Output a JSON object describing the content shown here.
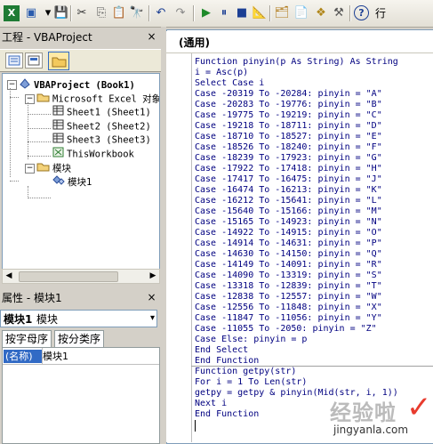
{
  "toolbar": {
    "buttons": [
      {
        "name": "excel-icon",
        "glyph": "X",
        "color": "#1e7b34"
      },
      {
        "name": "insert-userform-icon",
        "glyph": "▣",
        "color": "#2b5cad"
      },
      {
        "name": "dropdown-arrow-icon",
        "glyph": "▾",
        "color": "#000"
      },
      {
        "name": "save-icon",
        "glyph": "💾",
        "color": "#1c3f94"
      },
      {
        "name": "cut-icon",
        "glyph": "✂",
        "color": "#333"
      },
      {
        "name": "copy-icon",
        "glyph": "⎘",
        "color": "#555"
      },
      {
        "name": "paste-icon",
        "glyph": "📋",
        "color": "#8a6d1c"
      },
      {
        "name": "find-icon",
        "glyph": "🔭",
        "color": "#333"
      },
      {
        "name": "undo-icon",
        "glyph": "↶",
        "color": "#1c3f94"
      },
      {
        "name": "redo-icon",
        "glyph": "↷",
        "color": "#888"
      },
      {
        "name": "run-icon",
        "glyph": "▶",
        "color": "#1e8a2a"
      },
      {
        "name": "break-icon",
        "glyph": "⏸",
        "color": "#1c3f94"
      },
      {
        "name": "reset-icon",
        "glyph": "■",
        "color": "#1c3f94"
      },
      {
        "name": "design-mode-icon",
        "glyph": "📐",
        "color": "#1c3f94"
      },
      {
        "name": "project-explorer-icon",
        "glyph": "🗂",
        "color": "#b07a1a"
      },
      {
        "name": "properties-window-icon",
        "glyph": "📄",
        "color": "#3a6bbf"
      },
      {
        "name": "object-browser-icon",
        "glyph": "❖",
        "color": "#b0861a"
      },
      {
        "name": "toolbox-icon",
        "glyph": "⚒",
        "color": "#555"
      },
      {
        "name": "help-icon",
        "glyph": "?",
        "color": "#1c3f94"
      },
      {
        "name": "line-indicator",
        "glyph": "行",
        "color": "#000"
      }
    ]
  },
  "project_pane": {
    "title": "工程 - VBAProject",
    "close": "×",
    "tree": [
      {
        "label": "VBAProject (Book1)",
        "level": 0,
        "kind": "project"
      },
      {
        "label": "Microsoft Excel 对象",
        "level": 1,
        "kind": "folder"
      },
      {
        "label": "Sheet1 (Sheet1)",
        "level": 2,
        "kind": "sheet"
      },
      {
        "label": "Sheet2 (Sheet2)",
        "level": 2,
        "kind": "sheet"
      },
      {
        "label": "Sheet3 (Sheet3)",
        "level": 2,
        "kind": "sheet"
      },
      {
        "label": "ThisWorkbook",
        "level": 2,
        "kind": "workbook"
      },
      {
        "label": "模块",
        "level": 1,
        "kind": "folder"
      },
      {
        "label": "模块1",
        "level": 2,
        "kind": "module"
      }
    ]
  },
  "properties_pane": {
    "title": "属性 - 模块1",
    "close": "×",
    "object": "模块1",
    "object_type": "模块",
    "tabs": [
      "按字母序",
      "按分类序"
    ],
    "rows": [
      {
        "name": "(名称)",
        "value": "模块1"
      }
    ]
  },
  "code_window": {
    "object_combo": "(通用)",
    "lines": [
      "Function pinyin(p As String) As String",
      "i = Asc(p)",
      "Select Case i",
      "Case -20319 To -20284: pinyin = \"A\"",
      "Case -20283 To -19776: pinyin = \"B\"",
      "Case -19775 To -19219: pinyin = \"C\"",
      "Case -19218 To -18711: pinyin = \"D\"",
      "Case -18710 To -18527: pinyin = \"E\"",
      "Case -18526 To -18240: pinyin = \"F\"",
      "Case -18239 To -17923: pinyin = \"G\"",
      "Case -17922 To -17418: pinyin = \"H\"",
      "Case -17417 To -16475: pinyin = \"J\"",
      "Case -16474 To -16213: pinyin = \"K\"",
      "Case -16212 To -15641: pinyin = \"L\"",
      "Case -15640 To -15166: pinyin = \"M\"",
      "Case -15165 To -14923: pinyin = \"N\"",
      "Case -14922 To -14915: pinyin = \"O\"",
      "Case -14914 To -14631: pinyin = \"P\"",
      "Case -14630 To -14150: pinyin = \"Q\"",
      "Case -14149 To -14091: pinyin = \"R\"",
      "Case -14090 To -13319: pinyin = \"S\"",
      "Case -13318 To -12839: pinyin = \"T\"",
      "Case -12838 To -12557: pinyin = \"W\"",
      "Case -12556 To -11848: pinyin = \"X\"",
      "Case -11847 To -11056: pinyin = \"Y\"",
      "Case -11055 To -2050: pinyin = \"Z\"",
      "Case Else: pinyin = p",
      "End Select",
      "End Function",
      "Function getpy(str)",
      "For i = 1 To Len(str)",
      "getpy = getpy & pinyin(Mid(str, i, 1))",
      "Next i",
      "End Function"
    ]
  },
  "watermark": {
    "text": "经验啦",
    "site": "jingyanla.com",
    "check": "✓"
  }
}
